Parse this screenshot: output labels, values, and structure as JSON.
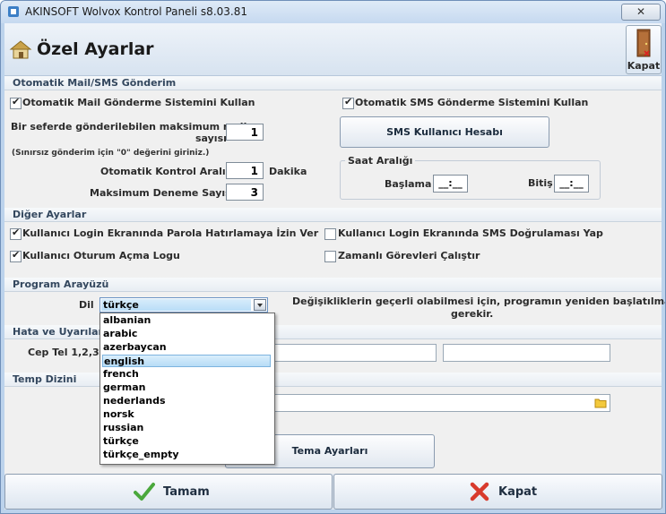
{
  "window": {
    "title": "AKINSOFT Wolvox Kontrol Paneli s8.03.81",
    "close_glyph": "✕"
  },
  "header": {
    "title": "Özel Ayarlar",
    "close_label": "Kapat"
  },
  "mail_sms": {
    "section_title": "Otomatik Mail/SMS Gönderim",
    "mail_check": {
      "label": "Otomatik Mail Gönderme Sistemini Kullan",
      "checked": true
    },
    "sms_check": {
      "label": "Otomatik SMS Gönderme Sistemini Kullan",
      "checked": true
    },
    "max_mail_label_1": "Bir seferde gönderilebilen maksimum mail",
    "max_mail_label_2": "sayısı",
    "max_mail_value": "1",
    "note": "(Sınırsız gönderim için \"0\" değerini giriniz.)",
    "interval_label": "Otomatik Kontrol Aralığı",
    "interval_value": "1",
    "interval_unit": "Dakika",
    "max_try_label": "Maksimum Deneme Sayısı",
    "max_try_value": "3",
    "sms_account_button": "SMS Kullanıcı Hesabı",
    "time_range": {
      "title": "Saat Aralığı",
      "start_label": "Başlama",
      "start_value": "__:__",
      "end_label": "Bitiş",
      "end_value": "__:__"
    }
  },
  "other": {
    "section_title": "Diğer Ayarlar",
    "remember_password": {
      "label": "Kullanıcı Login Ekranında Parola Hatırlamaya İzin Ver",
      "checked": true
    },
    "sms_verify": {
      "label": "Kullanıcı Login Ekranında SMS Doğrulaması Yap",
      "checked": false
    },
    "session_log": {
      "label": "Kullanıcı Oturum Açma Logu",
      "checked": true
    },
    "scheduled_tasks": {
      "label": "Zamanlı Görevleri Çalıştır",
      "checked": false
    }
  },
  "ui": {
    "section_title": "Program Arayüzü",
    "language_label": "Dil",
    "language_value": "türkçe",
    "restart_note_1": "Değişikliklerin geçerli olabilmesi için, programın yeniden başlatılması",
    "restart_note_2": "gerekir.",
    "languages": [
      "albanian",
      "arabic",
      "azerbaycan",
      "english",
      "french",
      "german",
      "nederlands",
      "norsk",
      "russian",
      "türkçe",
      "türkçe_empty"
    ],
    "highlighted_language": "english"
  },
  "errors": {
    "section_title": "Hata ve Uyarılar",
    "phone_label": "Cep Tel 1,2,3"
  },
  "temp": {
    "section_title": "Temp Dizini"
  },
  "theme_button": "Tema Ayarları",
  "footer": {
    "ok_label": "Tamam",
    "cancel_label": "Kapat"
  },
  "colors": {
    "accent": "#6a93c4",
    "ok_check": "#4aa83c",
    "cancel_x": "#d83a2c"
  }
}
